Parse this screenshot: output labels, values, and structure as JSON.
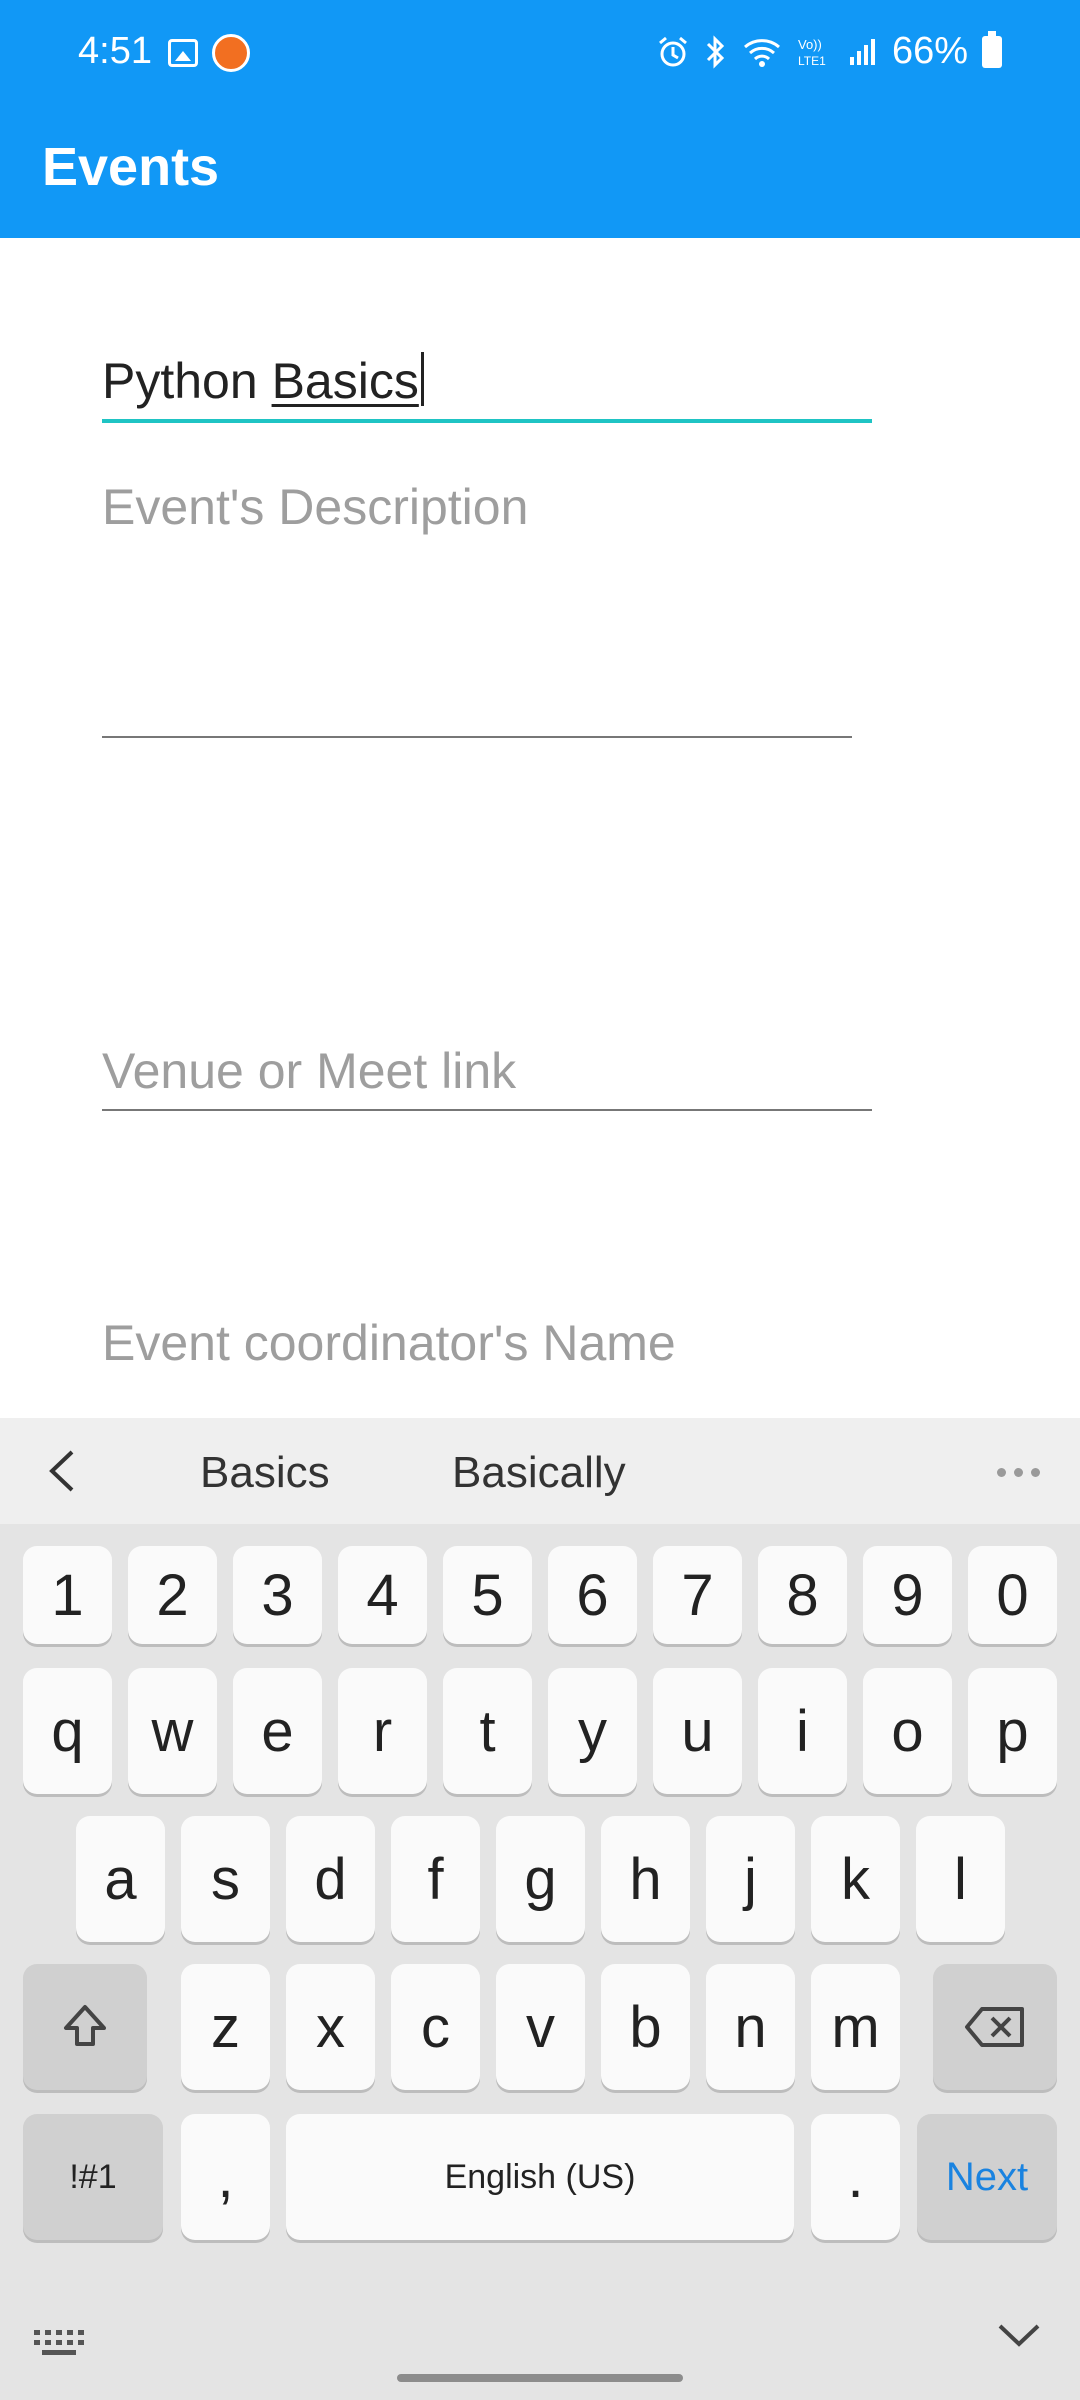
{
  "status_bar": {
    "time": "4:51",
    "battery": "66%",
    "icons": [
      "gallery-icon",
      "mi-icon",
      "alarm-icon",
      "bluetooth-icon",
      "wifi-icon",
      "volte-icon",
      "signal-icon",
      "battery-icon"
    ]
  },
  "app_bar": {
    "title": "Events",
    "color": "#1198f6"
  },
  "form": {
    "event_name": {
      "value_prefix": "Python ",
      "value_word": "Basics"
    },
    "description": {
      "placeholder": "Event's Description"
    },
    "venue": {
      "placeholder": "Venue or Meet link"
    },
    "coordinator": {
      "placeholder": "Event coordinator's Name"
    }
  },
  "keyboard": {
    "suggestions": [
      "Basics",
      "Basically"
    ],
    "numbers": [
      "1",
      "2",
      "3",
      "4",
      "5",
      "6",
      "7",
      "8",
      "9",
      "0"
    ],
    "row1": [
      "q",
      "w",
      "e",
      "r",
      "t",
      "y",
      "u",
      "i",
      "o",
      "p"
    ],
    "row2": [
      "a",
      "s",
      "d",
      "f",
      "g",
      "h",
      "j",
      "k",
      "l"
    ],
    "row3": [
      "z",
      "x",
      "c",
      "v",
      "b",
      "n",
      "m"
    ],
    "symbols_label": "!#1",
    "comma": ",",
    "space_label": "English (US)",
    "period": ".",
    "action_label": "Next",
    "accent_color": "#1a83e0"
  }
}
